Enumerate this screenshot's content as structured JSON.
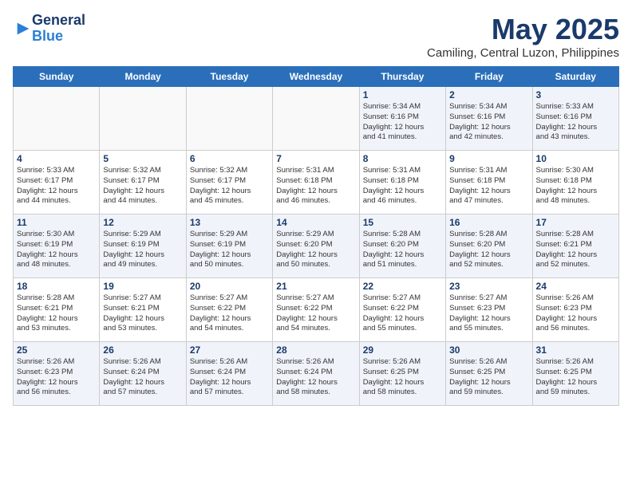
{
  "header": {
    "logo_line1": "General",
    "logo_line2": "Blue",
    "title": "May 2025",
    "subtitle": "Camiling, Central Luzon, Philippines"
  },
  "weekdays": [
    "Sunday",
    "Monday",
    "Tuesday",
    "Wednesday",
    "Thursday",
    "Friday",
    "Saturday"
  ],
  "weeks": [
    [
      {
        "day": "",
        "info": ""
      },
      {
        "day": "",
        "info": ""
      },
      {
        "day": "",
        "info": ""
      },
      {
        "day": "",
        "info": ""
      },
      {
        "day": "1",
        "info": "Sunrise: 5:34 AM\nSunset: 6:16 PM\nDaylight: 12 hours\nand 41 minutes."
      },
      {
        "day": "2",
        "info": "Sunrise: 5:34 AM\nSunset: 6:16 PM\nDaylight: 12 hours\nand 42 minutes."
      },
      {
        "day": "3",
        "info": "Sunrise: 5:33 AM\nSunset: 6:16 PM\nDaylight: 12 hours\nand 43 minutes."
      }
    ],
    [
      {
        "day": "4",
        "info": "Sunrise: 5:33 AM\nSunset: 6:17 PM\nDaylight: 12 hours\nand 44 minutes."
      },
      {
        "day": "5",
        "info": "Sunrise: 5:32 AM\nSunset: 6:17 PM\nDaylight: 12 hours\nand 44 minutes."
      },
      {
        "day": "6",
        "info": "Sunrise: 5:32 AM\nSunset: 6:17 PM\nDaylight: 12 hours\nand 45 minutes."
      },
      {
        "day": "7",
        "info": "Sunrise: 5:31 AM\nSunset: 6:18 PM\nDaylight: 12 hours\nand 46 minutes."
      },
      {
        "day": "8",
        "info": "Sunrise: 5:31 AM\nSunset: 6:18 PM\nDaylight: 12 hours\nand 46 minutes."
      },
      {
        "day": "9",
        "info": "Sunrise: 5:31 AM\nSunset: 6:18 PM\nDaylight: 12 hours\nand 47 minutes."
      },
      {
        "day": "10",
        "info": "Sunrise: 5:30 AM\nSunset: 6:18 PM\nDaylight: 12 hours\nand 48 minutes."
      }
    ],
    [
      {
        "day": "11",
        "info": "Sunrise: 5:30 AM\nSunset: 6:19 PM\nDaylight: 12 hours\nand 48 minutes."
      },
      {
        "day": "12",
        "info": "Sunrise: 5:29 AM\nSunset: 6:19 PM\nDaylight: 12 hours\nand 49 minutes."
      },
      {
        "day": "13",
        "info": "Sunrise: 5:29 AM\nSunset: 6:19 PM\nDaylight: 12 hours\nand 50 minutes."
      },
      {
        "day": "14",
        "info": "Sunrise: 5:29 AM\nSunset: 6:20 PM\nDaylight: 12 hours\nand 50 minutes."
      },
      {
        "day": "15",
        "info": "Sunrise: 5:28 AM\nSunset: 6:20 PM\nDaylight: 12 hours\nand 51 minutes."
      },
      {
        "day": "16",
        "info": "Sunrise: 5:28 AM\nSunset: 6:20 PM\nDaylight: 12 hours\nand 52 minutes."
      },
      {
        "day": "17",
        "info": "Sunrise: 5:28 AM\nSunset: 6:21 PM\nDaylight: 12 hours\nand 52 minutes."
      }
    ],
    [
      {
        "day": "18",
        "info": "Sunrise: 5:28 AM\nSunset: 6:21 PM\nDaylight: 12 hours\nand 53 minutes."
      },
      {
        "day": "19",
        "info": "Sunrise: 5:27 AM\nSunset: 6:21 PM\nDaylight: 12 hours\nand 53 minutes."
      },
      {
        "day": "20",
        "info": "Sunrise: 5:27 AM\nSunset: 6:22 PM\nDaylight: 12 hours\nand 54 minutes."
      },
      {
        "day": "21",
        "info": "Sunrise: 5:27 AM\nSunset: 6:22 PM\nDaylight: 12 hours\nand 54 minutes."
      },
      {
        "day": "22",
        "info": "Sunrise: 5:27 AM\nSunset: 6:22 PM\nDaylight: 12 hours\nand 55 minutes."
      },
      {
        "day": "23",
        "info": "Sunrise: 5:27 AM\nSunset: 6:23 PM\nDaylight: 12 hours\nand 55 minutes."
      },
      {
        "day": "24",
        "info": "Sunrise: 5:26 AM\nSunset: 6:23 PM\nDaylight: 12 hours\nand 56 minutes."
      }
    ],
    [
      {
        "day": "25",
        "info": "Sunrise: 5:26 AM\nSunset: 6:23 PM\nDaylight: 12 hours\nand 56 minutes."
      },
      {
        "day": "26",
        "info": "Sunrise: 5:26 AM\nSunset: 6:24 PM\nDaylight: 12 hours\nand 57 minutes."
      },
      {
        "day": "27",
        "info": "Sunrise: 5:26 AM\nSunset: 6:24 PM\nDaylight: 12 hours\nand 57 minutes."
      },
      {
        "day": "28",
        "info": "Sunrise: 5:26 AM\nSunset: 6:24 PM\nDaylight: 12 hours\nand 58 minutes."
      },
      {
        "day": "29",
        "info": "Sunrise: 5:26 AM\nSunset: 6:25 PM\nDaylight: 12 hours\nand 58 minutes."
      },
      {
        "day": "30",
        "info": "Sunrise: 5:26 AM\nSunset: 6:25 PM\nDaylight: 12 hours\nand 59 minutes."
      },
      {
        "day": "31",
        "info": "Sunrise: 5:26 AM\nSunset: 6:25 PM\nDaylight: 12 hours\nand 59 minutes."
      }
    ]
  ]
}
